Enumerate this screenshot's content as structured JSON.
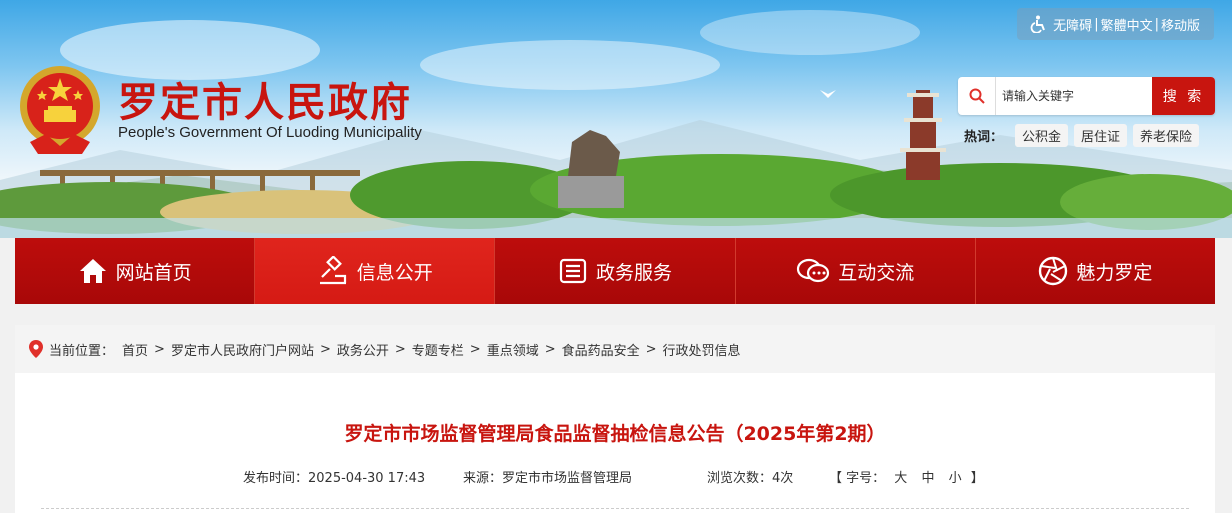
{
  "header": {
    "title": "罗定市人民政府",
    "subtitle": "People's Government Of Luoding Municipality",
    "accessibility": "无障碍",
    "traditional": "繁體中文",
    "mobile": "移动版",
    "search_placeholder": "请输入关键字",
    "search_button": "搜 索",
    "hot_label": "热词：",
    "hot_tags": [
      "公积金",
      "居住证",
      "养老保险"
    ],
    "colors": {
      "brand_red": "#c8150f",
      "sky": "#3fa7e6"
    }
  },
  "nav": {
    "items": [
      {
        "label": "网站首页",
        "icon": "home-icon"
      },
      {
        "label": "信息公开",
        "icon": "gavel-icon"
      },
      {
        "label": "政务服务",
        "icon": "list-icon"
      },
      {
        "label": "互动交流",
        "icon": "chat-icon"
      },
      {
        "label": "魅力罗定",
        "icon": "camera-aperture-icon"
      }
    ],
    "active": "信息公开"
  },
  "breadcrumb": {
    "label": "当前位置：",
    "items": [
      "首页",
      "罗定市人民政府门户网站",
      "政务公开",
      "专题专栏",
      "重点领域",
      "食品药品安全",
      "行政处罚信息"
    ]
  },
  "article": {
    "title": "罗定市市场监督管理局食品监督抽检信息公告（2025年第2期）",
    "publish": "发布时间：2025-04-30 17:43",
    "source": "来源：罗定市市场监督管理局",
    "views": "浏览次数：4次",
    "font_open": "【 字号：",
    "font_large": "大",
    "font_medium": "中",
    "font_small": "小",
    "font_close": "】"
  }
}
